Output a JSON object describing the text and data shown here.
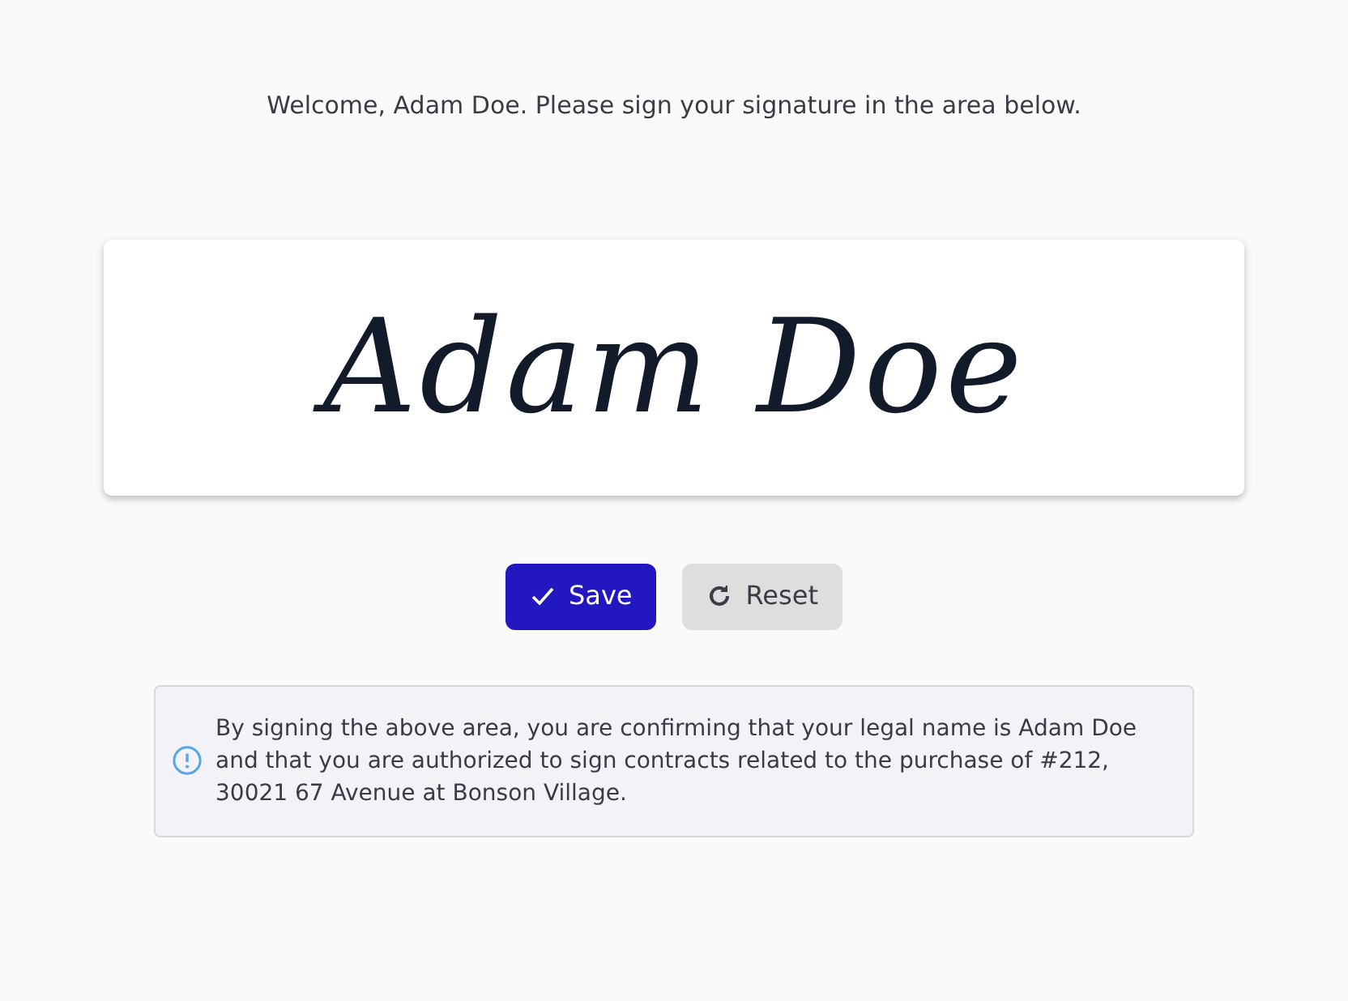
{
  "welcome": "Welcome, Adam Doe. Please sign your signature in the area below.",
  "signature_pad": {
    "signature": "Adam Doe"
  },
  "buttons": [
    {
      "kind": "primary",
      "label": "Save"
    },
    {
      "kind": "secondary",
      "label": "Reset"
    }
  ],
  "notice": "By signing the above area, you are confirming that your legal name is Adam Doe and that you are authorized to sign contracts related to the purchase of #212, 30021 67 Avenue at Bonson Village."
}
